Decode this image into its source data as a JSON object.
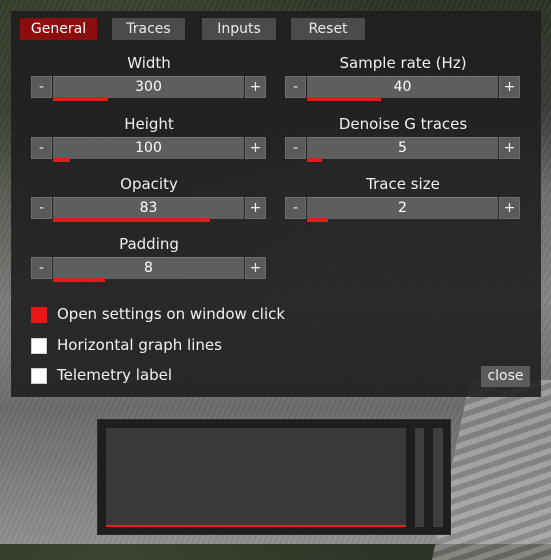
{
  "tabs": [
    {
      "label": "General",
      "active": true
    },
    {
      "label": "Traces",
      "active": false
    },
    {
      "label": "Inputs",
      "active": false
    },
    {
      "label": "Reset",
      "active": false
    }
  ],
  "settings": {
    "width": {
      "label": "Width",
      "value": "300",
      "level": 0.29
    },
    "height": {
      "label": "Height",
      "value": "100",
      "level": 0.09
    },
    "opacity": {
      "label": "Opacity",
      "value": "83",
      "level": 0.82
    },
    "padding": {
      "label": "Padding",
      "value": "8",
      "level": 0.27
    },
    "sample_rate": {
      "label": "Sample rate (Hz)",
      "value": "40",
      "level": 0.39
    },
    "denoise": {
      "label": "Denoise G traces",
      "value": "5",
      "level": 0.08
    },
    "trace_size": {
      "label": "Trace size",
      "value": "2",
      "level": 0.11
    }
  },
  "controls": {
    "minus": "-",
    "plus": "+"
  },
  "checkboxes": [
    {
      "label": "Open settings on window click",
      "checked": true
    },
    {
      "label": "Horizontal graph lines",
      "checked": false
    },
    {
      "label": "Telemetry label",
      "checked": false
    }
  ],
  "close_label": "close",
  "colors": {
    "accent": "#e31b1b",
    "active_tab": "#8b0d0d"
  }
}
